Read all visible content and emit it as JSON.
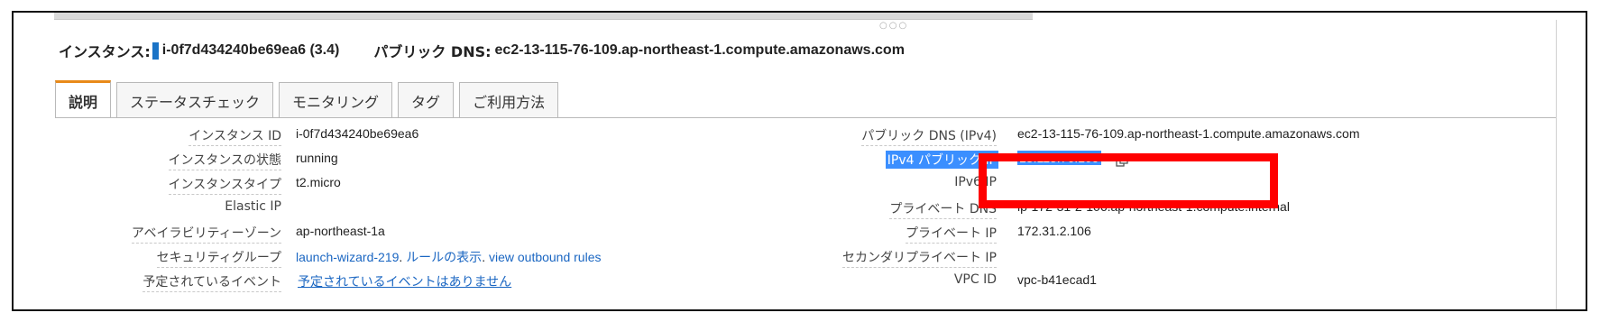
{
  "header": {
    "instance_label": "インスタンス:",
    "instance_value": "i-0f7d434240be69ea6 (3.4)",
    "dns_label": "パブリック DNS:",
    "dns_value": "ec2-13-115-76-109.ap-northeast-1.compute.amazonaws.com"
  },
  "tabs": [
    {
      "label": "説明"
    },
    {
      "label": "ステータスチェック"
    },
    {
      "label": "モニタリング"
    },
    {
      "label": "タグ"
    },
    {
      "label": "ご利用方法"
    }
  ],
  "left_fields": [
    {
      "label": "インスタンス ID",
      "value": "i-0f7d434240be69ea6"
    },
    {
      "label": "インスタンスの状態",
      "value": "running"
    },
    {
      "label": "インスタンスタイプ",
      "value": "t2.micro"
    },
    {
      "label": "Elastic IP",
      "value": ""
    },
    {
      "label": "アベイラビリティーゾーン",
      "value": "ap-northeast-1a"
    },
    {
      "label": "セキュリティグループ",
      "links": [
        "launch-wizard-219",
        "ルールの表示",
        "view outbound rules"
      ],
      "separator": "."
    },
    {
      "label": "予定されているイベント",
      "value": "予定されているイベントはありません"
    }
  ],
  "right_fields": [
    {
      "label": "パブリック DNS (IPv4)",
      "value": "ec2-13-115-76-109.ap-northeast-1.compute.amazonaws.com"
    },
    {
      "label": "IPv4 パブリック IP",
      "value": "13.115.76.109"
    },
    {
      "label": "IPv6 IP",
      "value": ""
    },
    {
      "label": "プライベート DNS",
      "value": "ip-172-31-2-106.ap-northeast-1.compute.internal"
    },
    {
      "label": "プライベート IP",
      "value": "172.31.2.106"
    },
    {
      "label": "セカンダリプライベート IP",
      "value": ""
    },
    {
      "label": "VPC ID",
      "value": "vpc-b41ecad1"
    }
  ],
  "colors": {
    "accent": "#1a73c6",
    "highlight": "#ff0000",
    "selection": "#3b8fff",
    "active_tab_top": "#e88a1a"
  },
  "icons": {
    "copy": "copy-icon",
    "drag": "drag-handle-icon"
  }
}
